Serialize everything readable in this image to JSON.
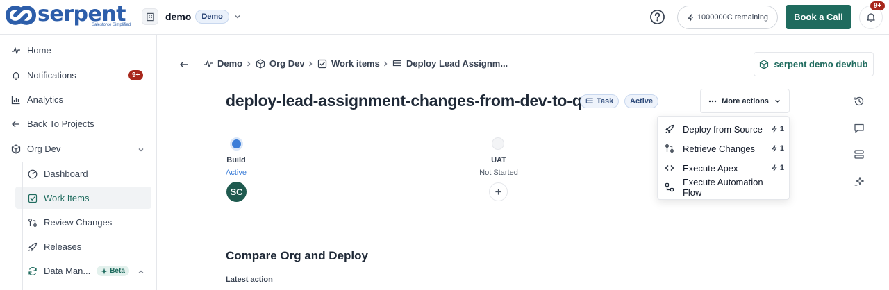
{
  "header": {
    "logo_text": "serpent",
    "logo_tagline": "Salesforce Simplified",
    "org_name": "demo",
    "org_badge": "Demo",
    "credits": "1000000C remaining",
    "book_call": "Book a Call",
    "notifications_badge": "9+"
  },
  "sidebar": {
    "home": "Home",
    "notifications": "Notifications",
    "notifications_badge": "9+",
    "analytics": "Analytics",
    "back": "Back To Projects",
    "org_dev": "Org Dev",
    "dashboard": "Dashboard",
    "work_items": "Work Items",
    "review_changes": "Review Changes",
    "releases": "Releases",
    "data_management": "Data Man...",
    "beta": "Beta"
  },
  "breadcrumb": {
    "items": [
      "Demo",
      "Org Dev",
      "Work items",
      "Deploy Lead Assignm..."
    ]
  },
  "devhub": "serpent demo devhub",
  "work_item": {
    "title": "deploy-lead-assignment-changes-from-dev-to-qa",
    "type_tag": "Task",
    "status_tag": "Active",
    "more_actions": "More actions"
  },
  "pipeline": {
    "stages": [
      {
        "name": "Build",
        "status": "Active",
        "assignee": "SC"
      },
      {
        "name": "UAT",
        "status": "Not Started"
      }
    ]
  },
  "menu": {
    "items": [
      {
        "label": "Deploy from Source",
        "count": "1"
      },
      {
        "label": "Retrieve Changes",
        "count": "1"
      },
      {
        "label": "Execute Apex",
        "count": "1"
      },
      {
        "label": "Execute Automation Flow",
        "count": ""
      }
    ]
  },
  "section": {
    "title": "Compare Org and Deploy",
    "latest_action_label": "Latest action"
  },
  "colors": {
    "brand": "#2d5eaa",
    "primary": "#1f6b5e",
    "badge": "#a8281c",
    "active_stage": "#3b7dd8"
  }
}
